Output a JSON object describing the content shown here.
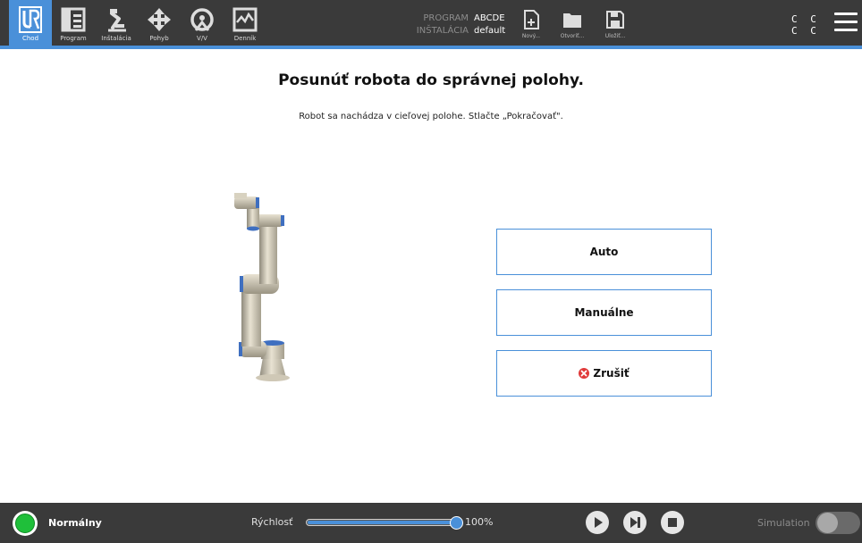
{
  "nav": {
    "items": [
      {
        "label": "Chod",
        "icon": "ur-logo-icon",
        "active": true
      },
      {
        "label": "Program",
        "icon": "program-icon"
      },
      {
        "label": "Inštalácia",
        "icon": "installation-icon"
      },
      {
        "label": "Pohyb",
        "icon": "move-icon"
      },
      {
        "label": "V/V",
        "icon": "io-icon"
      },
      {
        "label": "Denník",
        "icon": "log-icon"
      }
    ]
  },
  "program_info": {
    "program_key": "PROGRAM",
    "program_value": "ABCDE",
    "installation_key": "INŠTALÁCIA",
    "installation_value": "default"
  },
  "file_buttons": [
    {
      "label": "Nový...",
      "icon": "new-file-icon"
    },
    {
      "label": "Otvoriť...",
      "icon": "open-folder-icon"
    },
    {
      "label": "Uložiť...",
      "icon": "save-icon"
    }
  ],
  "cc": {
    "line1": "C C",
    "line2": "C C"
  },
  "main": {
    "title": "Posunúť robota do správnej polohy.",
    "subtitle": "Robot sa nachádza v cieľovej polohe. Stlačte „Pokračovať\".",
    "buttons": {
      "auto": "Auto",
      "manual": "Manuálne",
      "cancel": "Zrušiť"
    }
  },
  "bottom": {
    "status": "Normálny",
    "speed_label": "Rýchlosť",
    "speed_value": "100%",
    "speed_fraction": 1.0,
    "simulation_label": "Simulation"
  },
  "colors": {
    "accent": "#4a90d9",
    "bar": "#3a3a3a",
    "status_ok": "#1fbf3a",
    "cancel_red": "#e03a3a"
  }
}
